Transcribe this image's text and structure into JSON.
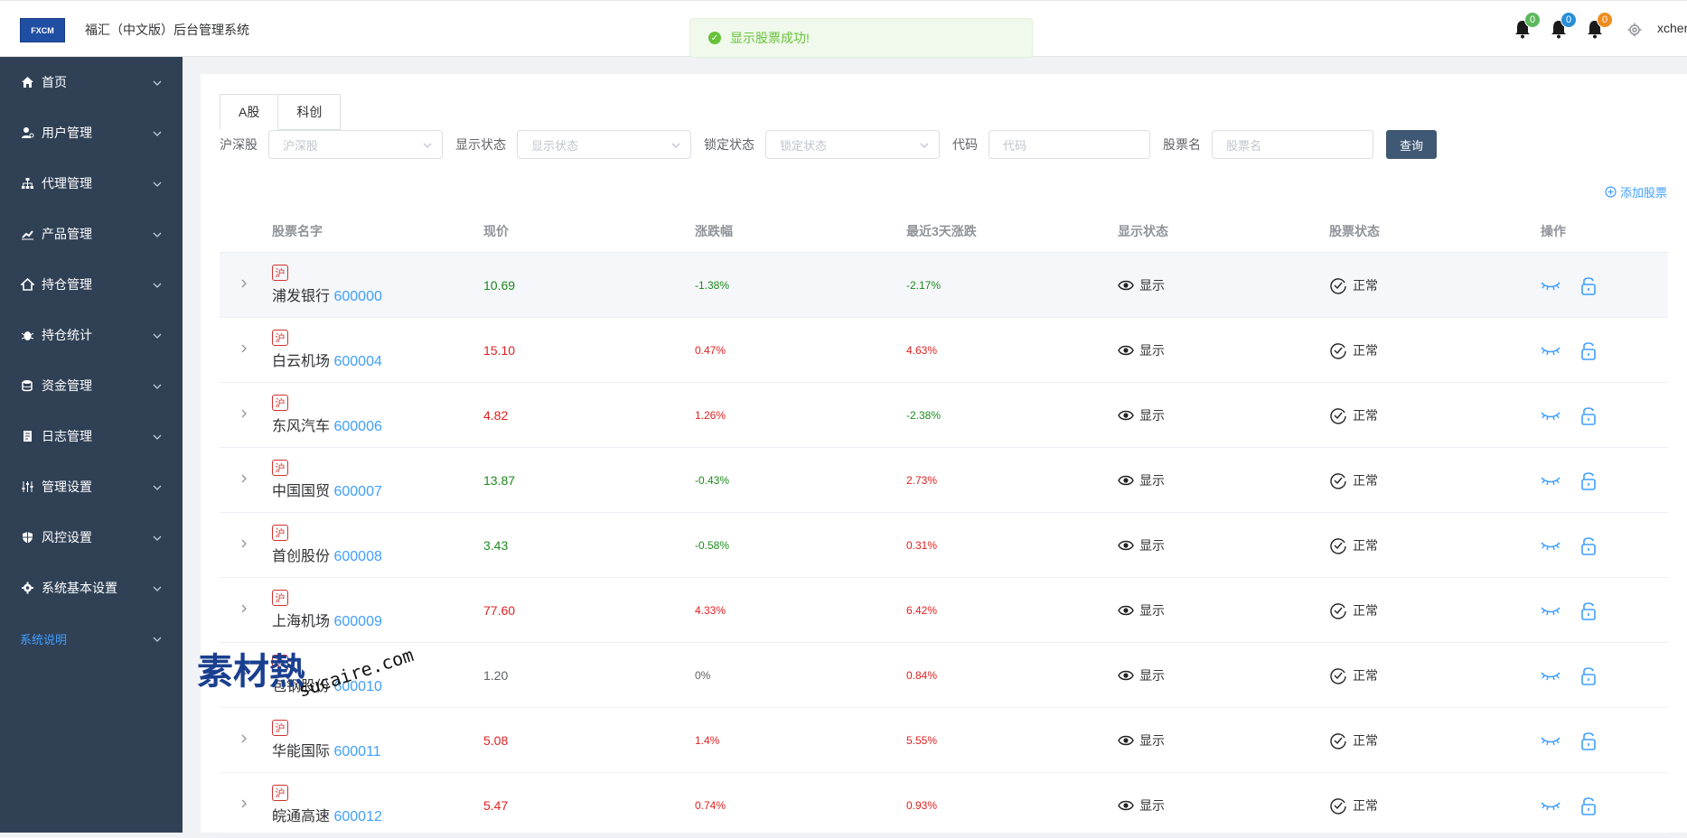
{
  "app": {
    "logo_text": "FXCM",
    "title": "福汇（中文版）后台管理系统",
    "username": "xchen"
  },
  "toast": {
    "message": "显示股票成功!"
  },
  "notifications": [
    {
      "count": "0",
      "color": "#5cb85c"
    },
    {
      "count": "0",
      "color": "#2a8fd6"
    },
    {
      "count": "0",
      "color": "#ef8c1e"
    }
  ],
  "sidebar": {
    "items": [
      {
        "label": "首页",
        "icon": "home-icon"
      },
      {
        "label": "用户管理",
        "icon": "user-icon"
      },
      {
        "label": "代理管理",
        "icon": "org-chart-icon"
      },
      {
        "label": "产品管理",
        "icon": "chart-icon"
      },
      {
        "label": "持仓管理",
        "icon": "house-icon"
      },
      {
        "label": "持仓统计",
        "icon": "bug-icon"
      },
      {
        "label": "资金管理",
        "icon": "database-icon"
      },
      {
        "label": "日志管理",
        "icon": "document-icon"
      },
      {
        "label": "管理设置",
        "icon": "sliders-icon"
      },
      {
        "label": "风控设置",
        "icon": "shield-icon"
      },
      {
        "label": "系统基本设置",
        "icon": "cog-icon"
      },
      {
        "label": "系统说明",
        "icon": ""
      }
    ]
  },
  "tabs": [
    {
      "label": "A股"
    },
    {
      "label": "科创"
    }
  ],
  "filters": {
    "market_label": "沪深股",
    "market_placeholder": "沪深股",
    "display_label": "显示状态",
    "display_placeholder": "显示状态",
    "lock_label": "锁定状态",
    "lock_placeholder": "锁定状态",
    "code_label": "代码",
    "code_placeholder": "代码",
    "name_label": "股票名",
    "name_placeholder": "股票名",
    "query_button": "查询"
  },
  "add_stock": "添加股票",
  "table": {
    "headers": [
      "股票名字",
      "现价",
      "涨跌幅",
      "最近3天涨跌",
      "显示状态",
      "股票状态",
      "操作"
    ],
    "rows": [
      {
        "tag": "沪",
        "name": "浦发银行",
        "code": "600000",
        "price": "10.69",
        "change": "-1.38%",
        "change3": "-2.17%",
        "display": "显示",
        "status": "正常",
        "price_trend": "down",
        "change_trend": "down",
        "change3_trend": "down"
      },
      {
        "tag": "沪",
        "name": "白云机场",
        "code": "600004",
        "price": "15.10",
        "change": "0.47%",
        "change3": "4.63%",
        "display": "显示",
        "status": "正常",
        "price_trend": "up",
        "change_trend": "up",
        "change3_trend": "up"
      },
      {
        "tag": "沪",
        "name": "东风汽车",
        "code": "600006",
        "price": "4.82",
        "change": "1.26%",
        "change3": "-2.38%",
        "display": "显示",
        "status": "正常",
        "price_trend": "up",
        "change_trend": "up",
        "change3_trend": "down"
      },
      {
        "tag": "沪",
        "name": "中国国贸",
        "code": "600007",
        "price": "13.87",
        "change": "-0.43%",
        "change3": "2.73%",
        "display": "显示",
        "status": "正常",
        "price_trend": "down",
        "change_trend": "down",
        "change3_trend": "up"
      },
      {
        "tag": "沪",
        "name": "首创股份",
        "code": "600008",
        "price": "3.43",
        "change": "-0.58%",
        "change3": "0.31%",
        "display": "显示",
        "status": "正常",
        "price_trend": "down",
        "change_trend": "down",
        "change3_trend": "up"
      },
      {
        "tag": "沪",
        "name": "上海机场",
        "code": "600009",
        "price": "77.60",
        "change": "4.33%",
        "change3": "6.42%",
        "display": "显示",
        "status": "正常",
        "price_trend": "up",
        "change_trend": "up",
        "change3_trend": "up"
      },
      {
        "tag": "沪",
        "name": "包钢股份",
        "code": "600010",
        "price": "1.20",
        "change": "0%",
        "change3": "0.84%",
        "display": "显示",
        "status": "正常",
        "price_trend": "flat",
        "change_trend": "flat",
        "change3_trend": "up"
      },
      {
        "tag": "沪",
        "name": "华能国际",
        "code": "600011",
        "price": "5.08",
        "change": "1.4%",
        "change3": "5.55%",
        "display": "显示",
        "status": "正常",
        "price_trend": "up",
        "change_trend": "up",
        "change3_trend": "up"
      },
      {
        "tag": "沪",
        "name": "皖通高速",
        "code": "600012",
        "price": "5.47",
        "change": "0.74%",
        "change3": "0.93%",
        "display": "显示",
        "status": "正常",
        "price_trend": "up",
        "change_trend": "up",
        "change3_trend": "up"
      }
    ]
  },
  "watermark": {
    "cn": "素材熱",
    "en": "sucaire.com"
  }
}
